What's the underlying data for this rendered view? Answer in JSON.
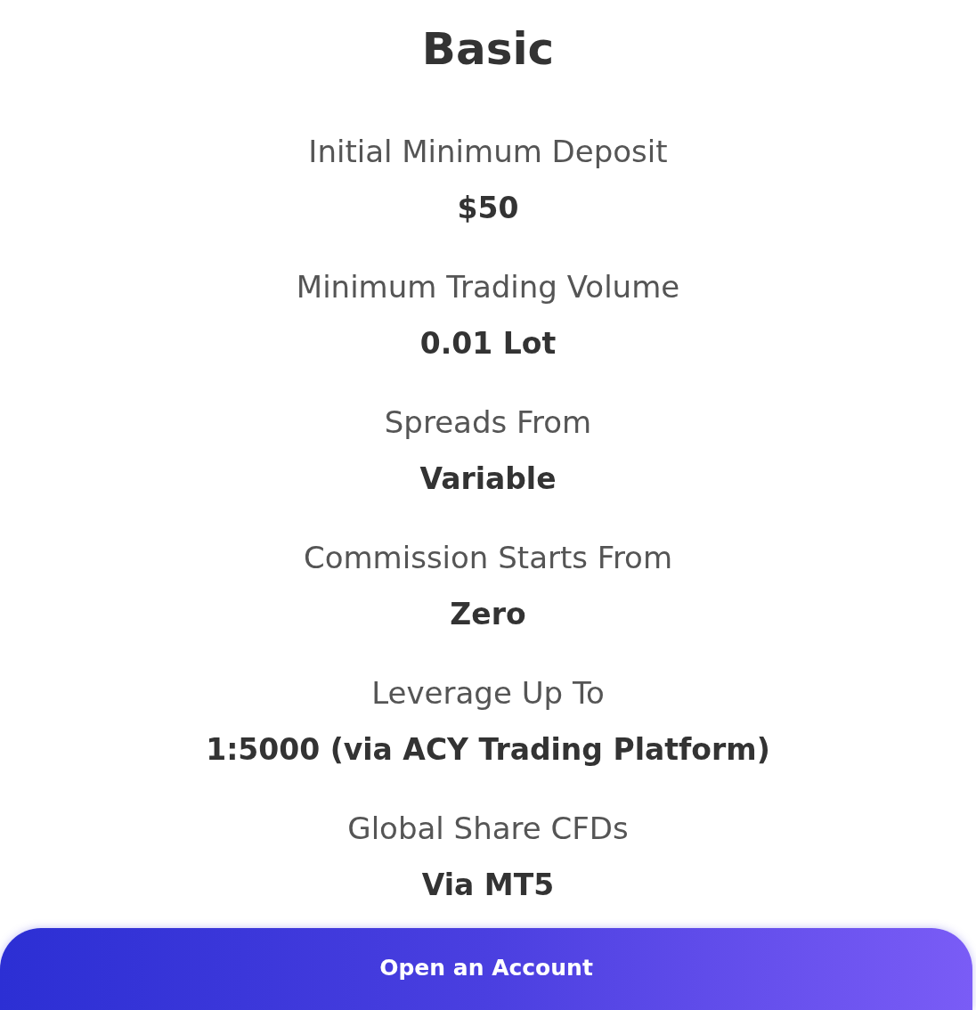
{
  "title": "Basic",
  "features": [
    {
      "label": "Initial Minimum Deposit",
      "value": "$50"
    },
    {
      "label": "Minimum Trading Volume",
      "value": "0.01 Lot"
    },
    {
      "label": "Spreads From",
      "value": "Variable"
    },
    {
      "label": "Commission Starts From",
      "value": "Zero"
    },
    {
      "label": "Leverage Up To",
      "value": "1:5000 (via ACY Trading Platform)"
    },
    {
      "label": "Global Share CFDs",
      "value": "Via MT5"
    }
  ],
  "button": {
    "label": "Open an Account"
  }
}
